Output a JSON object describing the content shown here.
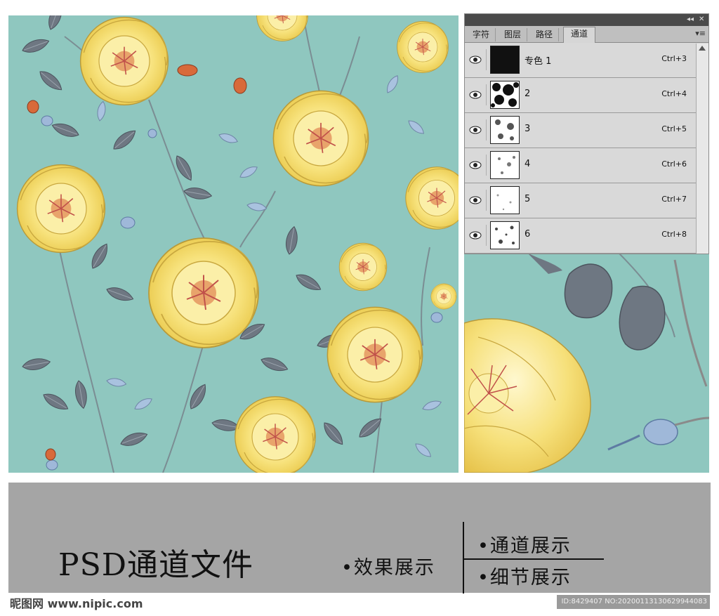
{
  "panel": {
    "tabs": [
      "字符",
      "图层",
      "路径",
      "通道"
    ],
    "active_tab": "通道",
    "channels": [
      {
        "name": "专色 1",
        "shortcut": "Ctrl+3"
      },
      {
        "name": "2",
        "shortcut": "Ctrl+4"
      },
      {
        "name": "3",
        "shortcut": "Ctrl+5"
      },
      {
        "name": "4",
        "shortcut": "Ctrl+6"
      },
      {
        "name": "5",
        "shortcut": "Ctrl+7"
      },
      {
        "name": "6",
        "shortcut": "Ctrl+8"
      }
    ],
    "collapse_glyph": "◂◂",
    "close_glyph": "✕",
    "menu_glyph": "▾≡"
  },
  "banner": {
    "title": "PSD通道文件",
    "item_effect": "•效果展示",
    "item_channel": "•通道展示",
    "item_detail": "•细节展示"
  },
  "footer": {
    "logo": "昵图网 www.nipic.com",
    "id_text": "ID:8429407 NO:20200113130629944083"
  },
  "colors": {
    "background": "#8fc7bf",
    "petal": "#f6e27a",
    "leaf": "#6e7782",
    "band": "#a5a5a5"
  }
}
